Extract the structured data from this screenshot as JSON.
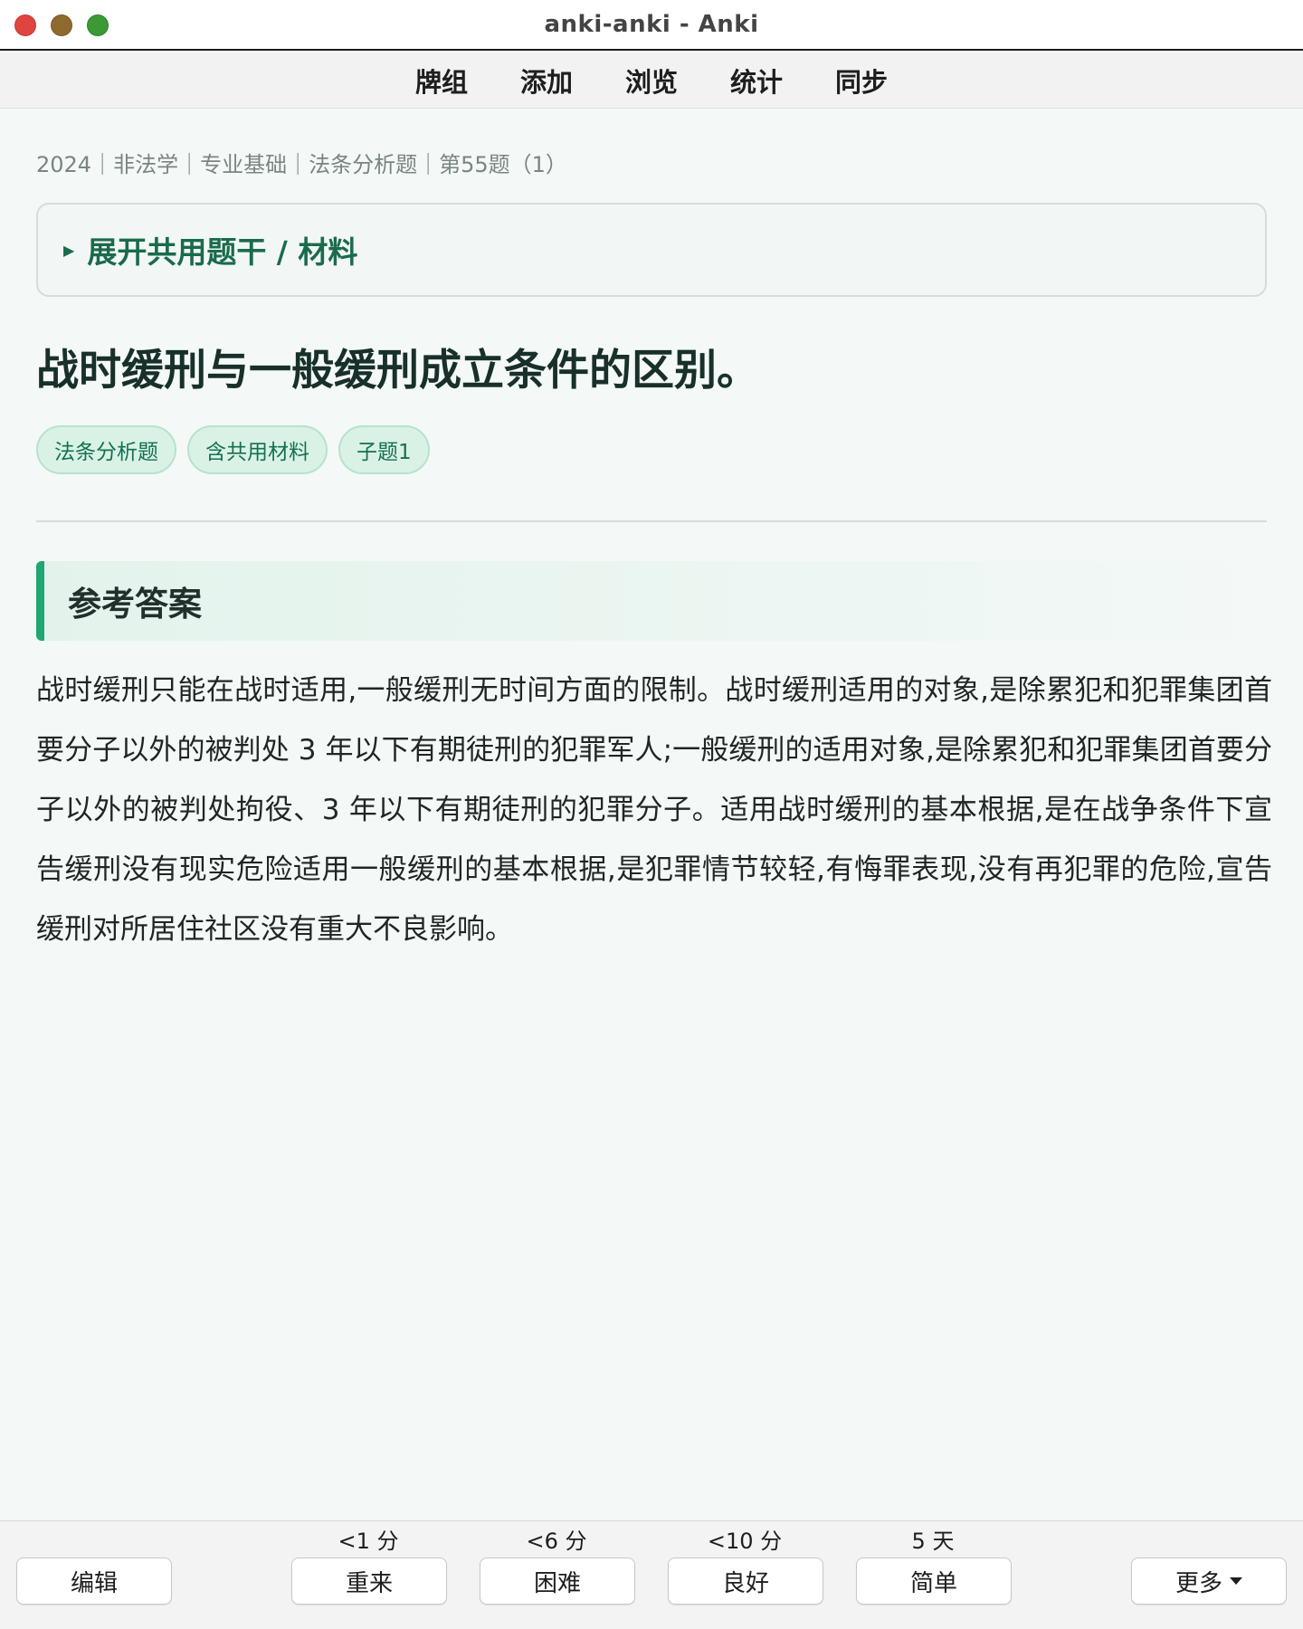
{
  "window": {
    "title": "anki-anki - Anki"
  },
  "nav": {
    "items": [
      "牌组",
      "添加",
      "浏览",
      "统计",
      "同步"
    ]
  },
  "card": {
    "breadcrumb": "2024｜非法学｜专业基础｜法条分析题｜第55题（1）",
    "expand_label": "展开共用题干 / 材料",
    "question": "战时缓刑与一般缓刑成立条件的区别。",
    "tags": [
      "法条分析题",
      "含共用材料",
      "子题1"
    ],
    "answer_heading": "参考答案",
    "answer_text": "战时缓刑只能在战时适用,一般缓刑无时间方面的限制。战时缓刑适用的对象,是除累犯和犯罪集团首要分子以外的被判处 3 年以下有期徒刑的犯罪军人;一般缓刑的适用对象,是除累犯和犯罪集团首要分子以外的被判处拘役、3 年以下有期徒刑的犯罪分子。适用战时缓刑的基本根据,是在战争条件下宣告缓刑没有现实危险适用一般缓刑的基本根据,是犯罪情节较轻,有悔罪表现,没有再犯罪的危险,宣告缓刑对所居住社区没有重大不良影响。"
  },
  "bottom": {
    "edit_label": "编辑",
    "more_label": "更多",
    "answers": [
      {
        "label": "重来",
        "interval": "<1 分"
      },
      {
        "label": "困难",
        "interval": "<6 分"
      },
      {
        "label": "良好",
        "interval": "<10 分"
      },
      {
        "label": "简单",
        "interval": "5 天"
      }
    ]
  },
  "colors": {
    "accent": "#1fa874",
    "expand_text": "#1a6b4b",
    "tag_bg": "#daf2e6",
    "tag_text": "#137151"
  }
}
